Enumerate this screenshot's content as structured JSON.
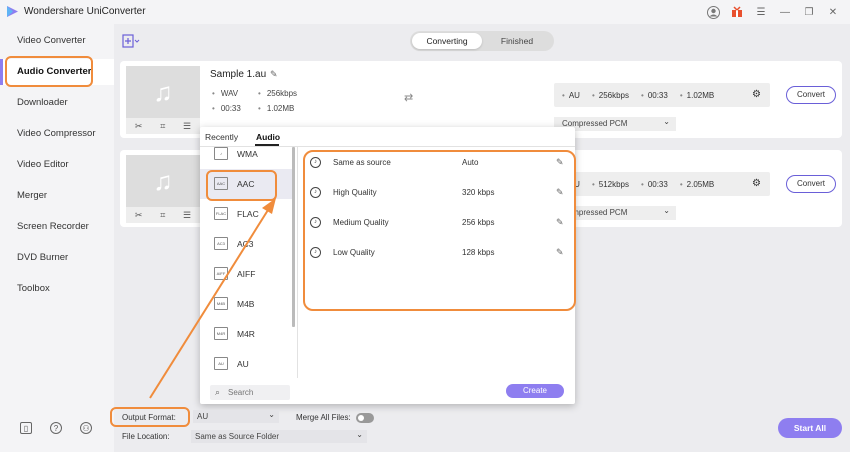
{
  "app": {
    "title": "Wondershare UniConverter",
    "accent_color": "#8e7ef0",
    "annotation_color": "#f08c3c"
  },
  "titlebar_icons": [
    "user-icon",
    "gift-icon",
    "menu-icon",
    "minimize-icon",
    "maximize-icon",
    "close-icon"
  ],
  "sidebar": {
    "items": [
      {
        "label": "Video Converter"
      },
      {
        "label": "Audio Converter",
        "active": true
      },
      {
        "label": "Downloader"
      },
      {
        "label": "Video Compressor"
      },
      {
        "label": "Video Editor"
      },
      {
        "label": "Merger"
      },
      {
        "label": "Screen Recorder"
      },
      {
        "label": "DVD Burner"
      },
      {
        "label": "Toolbox"
      }
    ],
    "bottom_icons": [
      "book-icon",
      "help-icon",
      "people-icon"
    ]
  },
  "tabs": {
    "converting": "Converting",
    "finished": "Finished",
    "active": "Converting"
  },
  "files": [
    {
      "name": "Sample 1.au",
      "format": "WAV",
      "bitrate": "256kbps",
      "duration": "00:33",
      "size": "1.02MB",
      "output": {
        "format": "AU",
        "bitrate": "256kbps",
        "duration": "00:33",
        "size": "1.02MB"
      },
      "codec": "Compressed PCM",
      "convert_label": "Convert"
    },
    {
      "output": {
        "format": "AU",
        "bitrate": "512kbps",
        "duration": "00:33",
        "size": "2.05MB"
      },
      "codec": "Compressed PCM",
      "convert_label": "Convert"
    }
  ],
  "popup": {
    "tabs": [
      "Recently",
      "Audio"
    ],
    "active_tab": "Audio",
    "formats": [
      {
        "label": "WMA",
        "icon": "wma-file-icon"
      },
      {
        "label": "AAC",
        "icon": "aac-file-icon",
        "selected": true
      },
      {
        "label": "FLAC",
        "icon": "flac-file-icon"
      },
      {
        "label": "AC3",
        "icon": "ac3-file-icon"
      },
      {
        "label": "AIFF",
        "icon": "aiff-file-icon"
      },
      {
        "label": "M4B",
        "icon": "m4b-file-icon"
      },
      {
        "label": "M4R",
        "icon": "m4r-file-icon"
      },
      {
        "label": "AU",
        "icon": "au-file-icon"
      }
    ],
    "qualities": [
      {
        "name": "Same as source",
        "value": "Auto"
      },
      {
        "name": "High Quality",
        "value": "320 kbps"
      },
      {
        "name": "Medium Quality",
        "value": "256 kbps"
      },
      {
        "name": "Low Quality",
        "value": "128 kbps"
      }
    ],
    "search_placeholder": "Search",
    "create_label": "Create"
  },
  "bottom": {
    "output_format_label": "Output Format:",
    "output_format_value": "AU",
    "merge_label": "Merge All Files:",
    "merge_enabled": false,
    "file_location_label": "File Location:",
    "file_location_value": "Same as Source Folder",
    "start_all_label": "Start All"
  }
}
